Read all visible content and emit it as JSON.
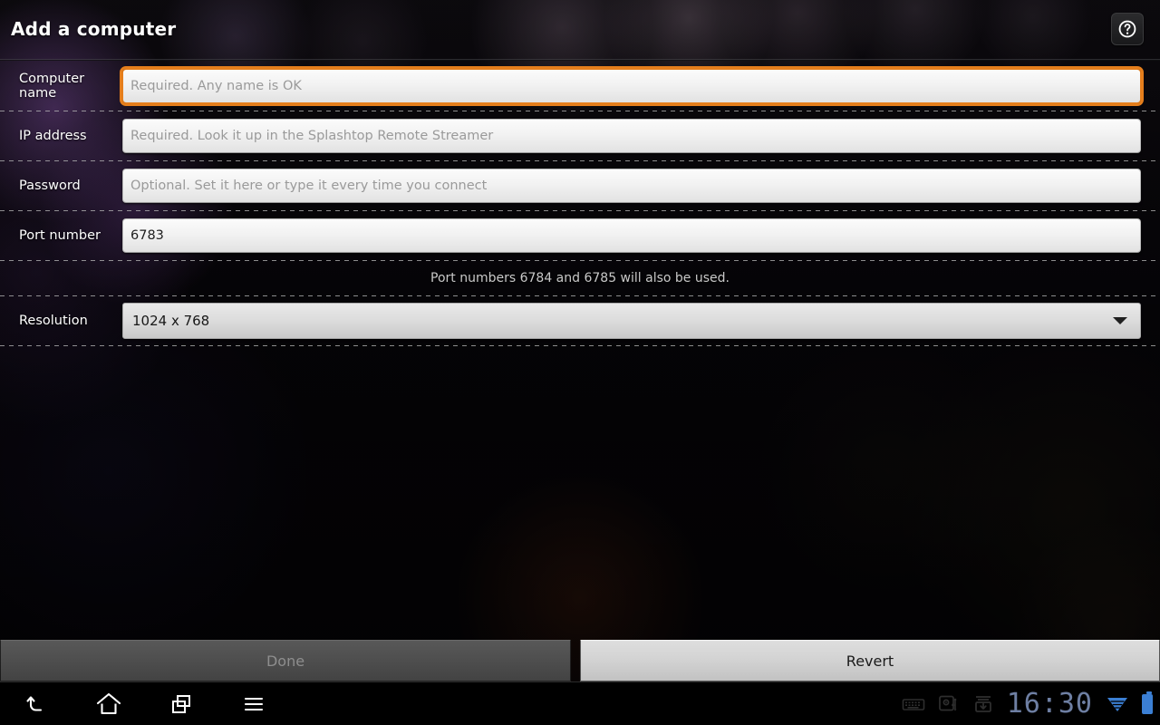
{
  "header": {
    "title": "Add a computer",
    "help_icon": "help-circle-icon"
  },
  "form": {
    "fields": [
      {
        "label": "Computer name",
        "placeholder": "Required. Any name is OK",
        "value": "",
        "focused": true,
        "name": "computer-name"
      },
      {
        "label": "IP address",
        "placeholder": "Required. Look it up in the Splashtop Remote Streamer",
        "value": "",
        "focused": false,
        "name": "ip-address"
      },
      {
        "label": "Password",
        "placeholder": "Optional. Set it here or type it every time you connect",
        "value": "",
        "focused": false,
        "name": "password"
      },
      {
        "label": "Port number",
        "placeholder": "",
        "value": "6783",
        "focused": false,
        "name": "port-number"
      }
    ],
    "hint": "Port numbers 6784 and 6785 will also be used.",
    "resolution": {
      "label": "Resolution",
      "selected": "1024 x 768"
    }
  },
  "actions": {
    "done_label": "Done",
    "revert_label": "Revert"
  },
  "navbar": {
    "back_icon": "back-arrow-icon",
    "home_icon": "home-icon",
    "recents_icon": "recent-apps-icon",
    "menu_icon": "menu-icon",
    "keyboard_icon": "keyboard-icon",
    "usb_storage_icon": "usb-storage-icon",
    "download_icon": "download-icon",
    "clock": "16:30",
    "wifi_icon": "wifi-icon",
    "battery_icon": "battery-icon"
  },
  "colors": {
    "focus_accent": "#e57e1c",
    "status_blue": "#3b7fd4",
    "clock_blue": "#6e7fa3",
    "glow_purple": "#7d4ea0"
  }
}
